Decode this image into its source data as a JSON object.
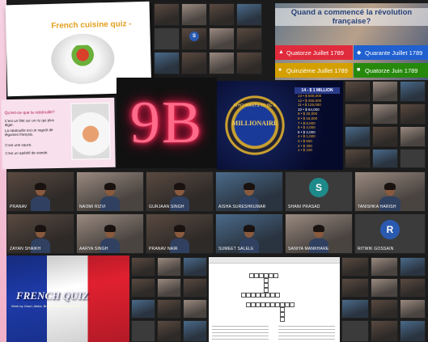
{
  "cuisine_slide": {
    "title": "French cuisine quiz -"
  },
  "revolution_quiz": {
    "question": "Quand a commencé la révolution française?",
    "answers": [
      {
        "symbol": "▲",
        "label": "Quatorze Juillet 1789",
        "color": "#e02b3c"
      },
      {
        "symbol": "◆",
        "label": "Quarante Juillet 1789",
        "color": "#2060d0"
      },
      {
        "symbol": "●",
        "label": "Quinzième Juillet 1789",
        "color": "#d4a000"
      },
      {
        "symbol": "■",
        "label": "Quatorze Juin 1789",
        "color": "#26890c"
      }
    ]
  },
  "pink_slide": {
    "question": "Qu'est-ce que la ratatouille?",
    "lines": [
      "C'est un filet sur un riz qui plus léger.",
      "La ratatouille est un ragoût de légumes français.",
      "C'est une sauce.",
      "C'est un apéritif de viande."
    ]
  },
  "neon": {
    "text": "9B"
  },
  "millionaire": {
    "top": "WHO WANTS TO BE A",
    "logo": "MILLIONAIRE",
    "ladder_head": "14 - $ 1 MILLION",
    "ladder": [
      "13 • $ 500,000",
      "12 • $ 250,000",
      "11 • $ 125,000",
      "10 • $ 64,000",
      "9 • $ 32,000",
      "8 • $ 16,000",
      "7 • $ 8,000",
      "6 • $ 4,000",
      "5 • $ 2,000",
      "4 • $ 1,000",
      "3 • $ 500",
      "2 • $ 300",
      "1 • $ 100"
    ]
  },
  "flag_slide": {
    "title": "FRENCH QUIZ",
    "subtitle": "Work by Gouri, Aisha, Brahmi, Pranav and Tanis"
  },
  "participants": {
    "row1": [
      "PRANAV",
      "NAOMI RIZVI",
      "GURJAAN SINGH",
      "AISHA SURESHKUMAR",
      "SHANI PRASAD",
      "TANISHKA HARISH"
    ],
    "row2": [
      "ZAYAN SHAIKH",
      "AARYA SINGH",
      "PRANAV NAIR",
      "SUMEET SALELE",
      "SANIYA MANKHARE",
      "RITWIK GOSSAIN"
    ],
    "avatar_s": "S",
    "avatar_r": "R"
  },
  "colors": {
    "neon": "#ff2d5a",
    "gold": "#f4d060",
    "avatar_teal": "#1f8a8a",
    "avatar_blue": "#2a5ab0"
  }
}
